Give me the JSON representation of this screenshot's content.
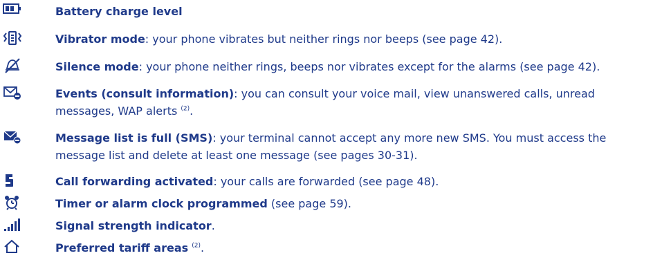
{
  "items": [
    {
      "icon": "battery-icon",
      "term": "Battery charge level",
      "desc": "",
      "note": "",
      "tail": ""
    },
    {
      "icon": "vibrate-icon",
      "term": "Vibrator mode",
      "desc": ": your phone vibrates but neither rings nor beeps (see page 42).",
      "note": "",
      "tail": ""
    },
    {
      "icon": "silence-icon",
      "term": "Silence mode",
      "desc": ": your phone neither rings, beeps nor vibrates except for the alarms (see page 42).",
      "note": "",
      "tail": ""
    },
    {
      "icon": "events-icon",
      "term": "Events (consult information)",
      "desc": ": you can consult your voice mail, view unanswered calls, unread messages, WAP alerts ",
      "note": "(2)",
      "tail": "."
    },
    {
      "icon": "message-full-icon",
      "term": "Message list is full (SMS)",
      "desc": ": your terminal cannot accept any more new SMS. You must access the message list and delete at least one message (see pages 30-31).",
      "note": "",
      "tail": ""
    },
    {
      "icon": "call-forward-icon",
      "term": "Call forwarding activated",
      "desc": ": your calls are forwarded (see page 48).",
      "note": "",
      "tail": ""
    },
    {
      "icon": "alarm-clock-icon",
      "term": "Timer or alarm clock programmed",
      "desc": " (see page 59).",
      "note": "",
      "tail": ""
    },
    {
      "icon": "signal-strength-icon",
      "term": "Signal strength indicator",
      "desc": ".",
      "note": "",
      "tail": ""
    },
    {
      "icon": "home-zone-icon",
      "term": "Preferred tariff areas",
      "desc": " ",
      "note": "(2)",
      "tail": "."
    }
  ]
}
